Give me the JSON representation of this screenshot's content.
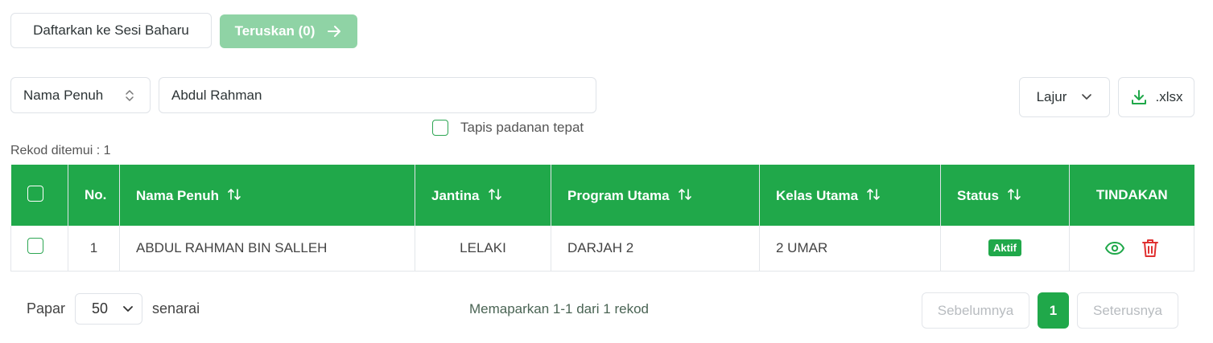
{
  "toolbar": {
    "register_label": "Daftarkan ke Sesi Baharu",
    "forward_label": "Teruskan (0)"
  },
  "filter": {
    "field_selected": "Nama Penuh",
    "search_value": "Abdul Rahman",
    "exact_match_label": "Tapis padanan tepat",
    "exact_match_checked": false
  },
  "actions": {
    "columns_label": "Lajur",
    "export_label": ".xlsx"
  },
  "record_count_text": "Rekod ditemui : 1",
  "table": {
    "headers": {
      "no": "No.",
      "name": "Nama Penuh",
      "gender": "Jantina",
      "program": "Program Utama",
      "class": "Kelas Utama",
      "status": "Status",
      "actions": "TINDAKAN"
    },
    "rows": [
      {
        "no": "1",
        "name": "ABDUL RAHMAN BIN SALLEH",
        "gender": "LELAKI",
        "program": "DARJAH 2",
        "class": "2 UMAR",
        "status": "Aktif"
      }
    ]
  },
  "footer": {
    "show_label": "Papar",
    "page_size": "50",
    "list_label": "senarai",
    "showing_text": "Memaparkan 1-1 dari 1 rekod",
    "prev_label": "Sebelumnya",
    "current_page": "1",
    "next_label": "Seterusnya"
  },
  "colors": {
    "primary_green": "#20a84a",
    "light_green": "#8fd3a5",
    "delete_red": "#e03131"
  },
  "icons": {
    "forward": "arrow-right-icon",
    "select": "chevron-updown-icon",
    "columns": "chevron-down-icon",
    "export": "download-icon",
    "sort": "sort-icon",
    "view": "eye-icon",
    "delete": "trash-icon"
  }
}
